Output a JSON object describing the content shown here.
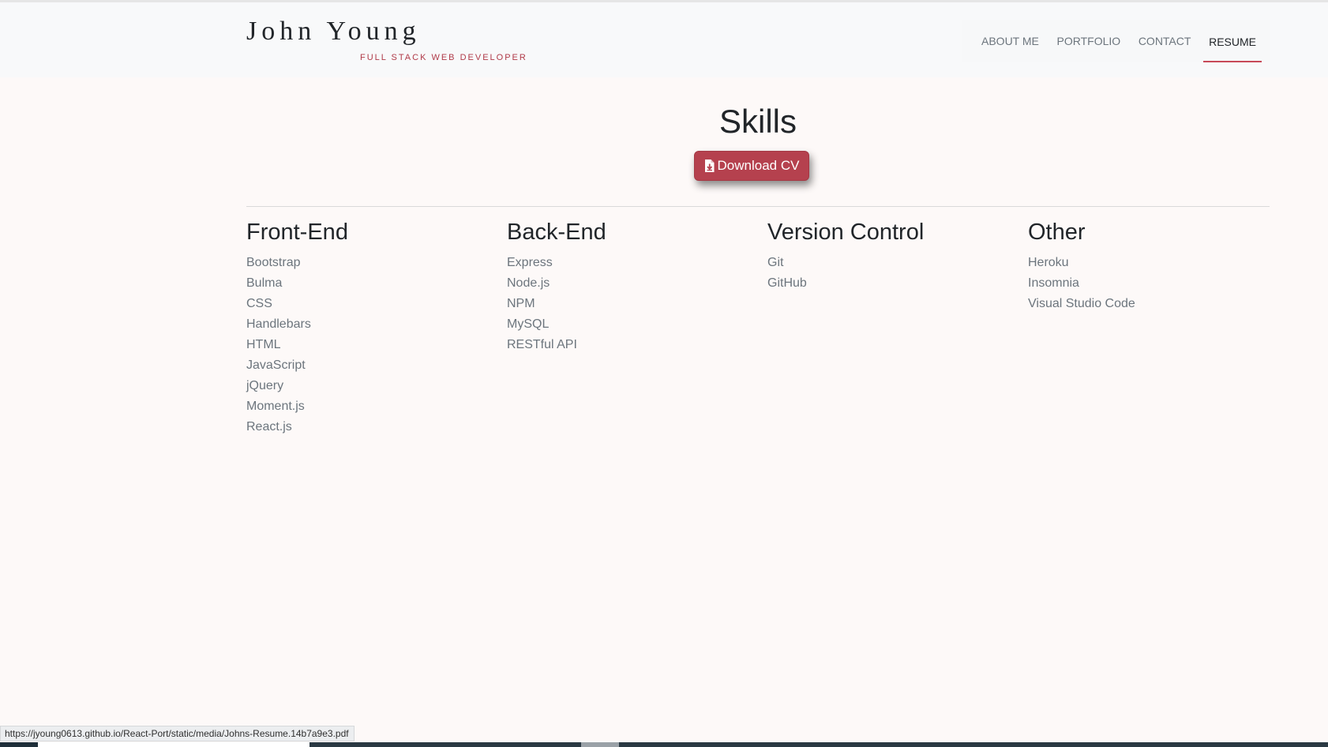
{
  "header": {
    "brand_name": "John Young",
    "brand_tagline": "FULL STACK WEB DEVELOPER",
    "nav": [
      {
        "label": "ABOUT ME",
        "active": false
      },
      {
        "label": "PORTFOLIO",
        "active": false
      },
      {
        "label": "CONTACT",
        "active": false
      },
      {
        "label": "RESUME",
        "active": true
      }
    ]
  },
  "main": {
    "title": "Skills",
    "download_button": {
      "label": "Download CV",
      "icon": "file-download-icon",
      "color": "#b5414e"
    },
    "columns": [
      {
        "heading": "Front-End",
        "items": [
          "Bootstrap",
          "Bulma",
          "CSS",
          "Handlebars",
          "HTML",
          "JavaScript",
          "jQuery",
          "Moment.js",
          "React.js"
        ]
      },
      {
        "heading": "Back-End",
        "items": [
          "Express",
          "Node.js",
          "NPM",
          "MySQL",
          "RESTful API"
        ]
      },
      {
        "heading": "Version Control",
        "items": [
          "Git",
          "GitHub"
        ]
      },
      {
        "heading": "Other",
        "items": [
          "Heroku",
          "Insomnia",
          "Visual Studio Code"
        ]
      }
    ]
  },
  "status_bar": {
    "url": "https://jyoung0613.github.io/React-Port/static/media/Johns-Resume.14b7a9e3.pdf"
  },
  "colors": {
    "accent": "#b5414e",
    "tagline": "#b03a48",
    "background": "#fdf9f8"
  }
}
